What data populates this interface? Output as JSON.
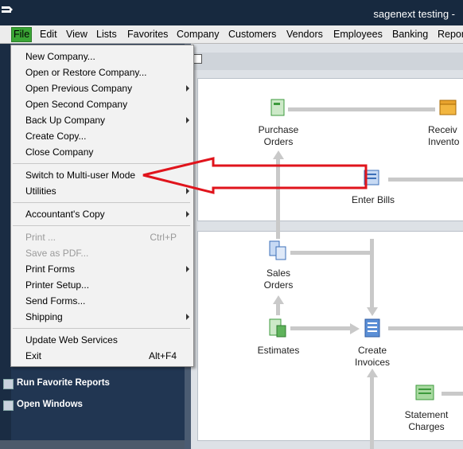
{
  "window": {
    "title": "sagenext testing  -"
  },
  "menubar": {
    "items": [
      "File",
      "Edit",
      "View",
      "Lists",
      "Favorites",
      "Company",
      "Customers",
      "Vendors",
      "Employees",
      "Banking",
      "Repor"
    ]
  },
  "file_menu": {
    "items": [
      {
        "label": "New Company...",
        "submenu": false
      },
      {
        "label": "Open or Restore Company...",
        "submenu": false
      },
      {
        "label": "Open Previous Company",
        "submenu": true
      },
      {
        "label": "Open Second Company",
        "submenu": false
      },
      {
        "label": "Back Up Company",
        "submenu": true
      },
      {
        "label": "Create Copy...",
        "submenu": false
      },
      {
        "label": "Close Company",
        "submenu": false
      },
      {
        "label": "Switch to Multi-user Mode",
        "submenu": false
      },
      {
        "label": "Utilities",
        "submenu": true
      },
      {
        "label": "Accountant's Copy",
        "submenu": true
      },
      {
        "label": "Print ...",
        "shortcut": "Ctrl+P",
        "disabled": true
      },
      {
        "label": "Save as PDF...",
        "disabled": true
      },
      {
        "label": "Print Forms",
        "submenu": true
      },
      {
        "label": "Printer Setup...",
        "submenu": false
      },
      {
        "label": "Send Forms...",
        "submenu": false
      },
      {
        "label": "Shipping",
        "submenu": true
      },
      {
        "label": "Update Web Services",
        "submenu": false
      },
      {
        "label": "Exit",
        "shortcut": "Alt+F4"
      }
    ]
  },
  "left_panel": {
    "run_favorite_reports": "Run Favorite Reports",
    "open_windows": "Open Windows"
  },
  "home": {
    "purchase_orders": "Purchase\nOrders",
    "receive_inventory": "Receiv\nInvento",
    "enter_bills": "Enter Bills",
    "sales_orders": "Sales\nOrders",
    "estimates": "Estimates",
    "create_invoices": "Create\nInvoices",
    "statement_charges": "Statement\nCharges"
  },
  "annotation": {
    "arrow_color": "#e0141c"
  }
}
